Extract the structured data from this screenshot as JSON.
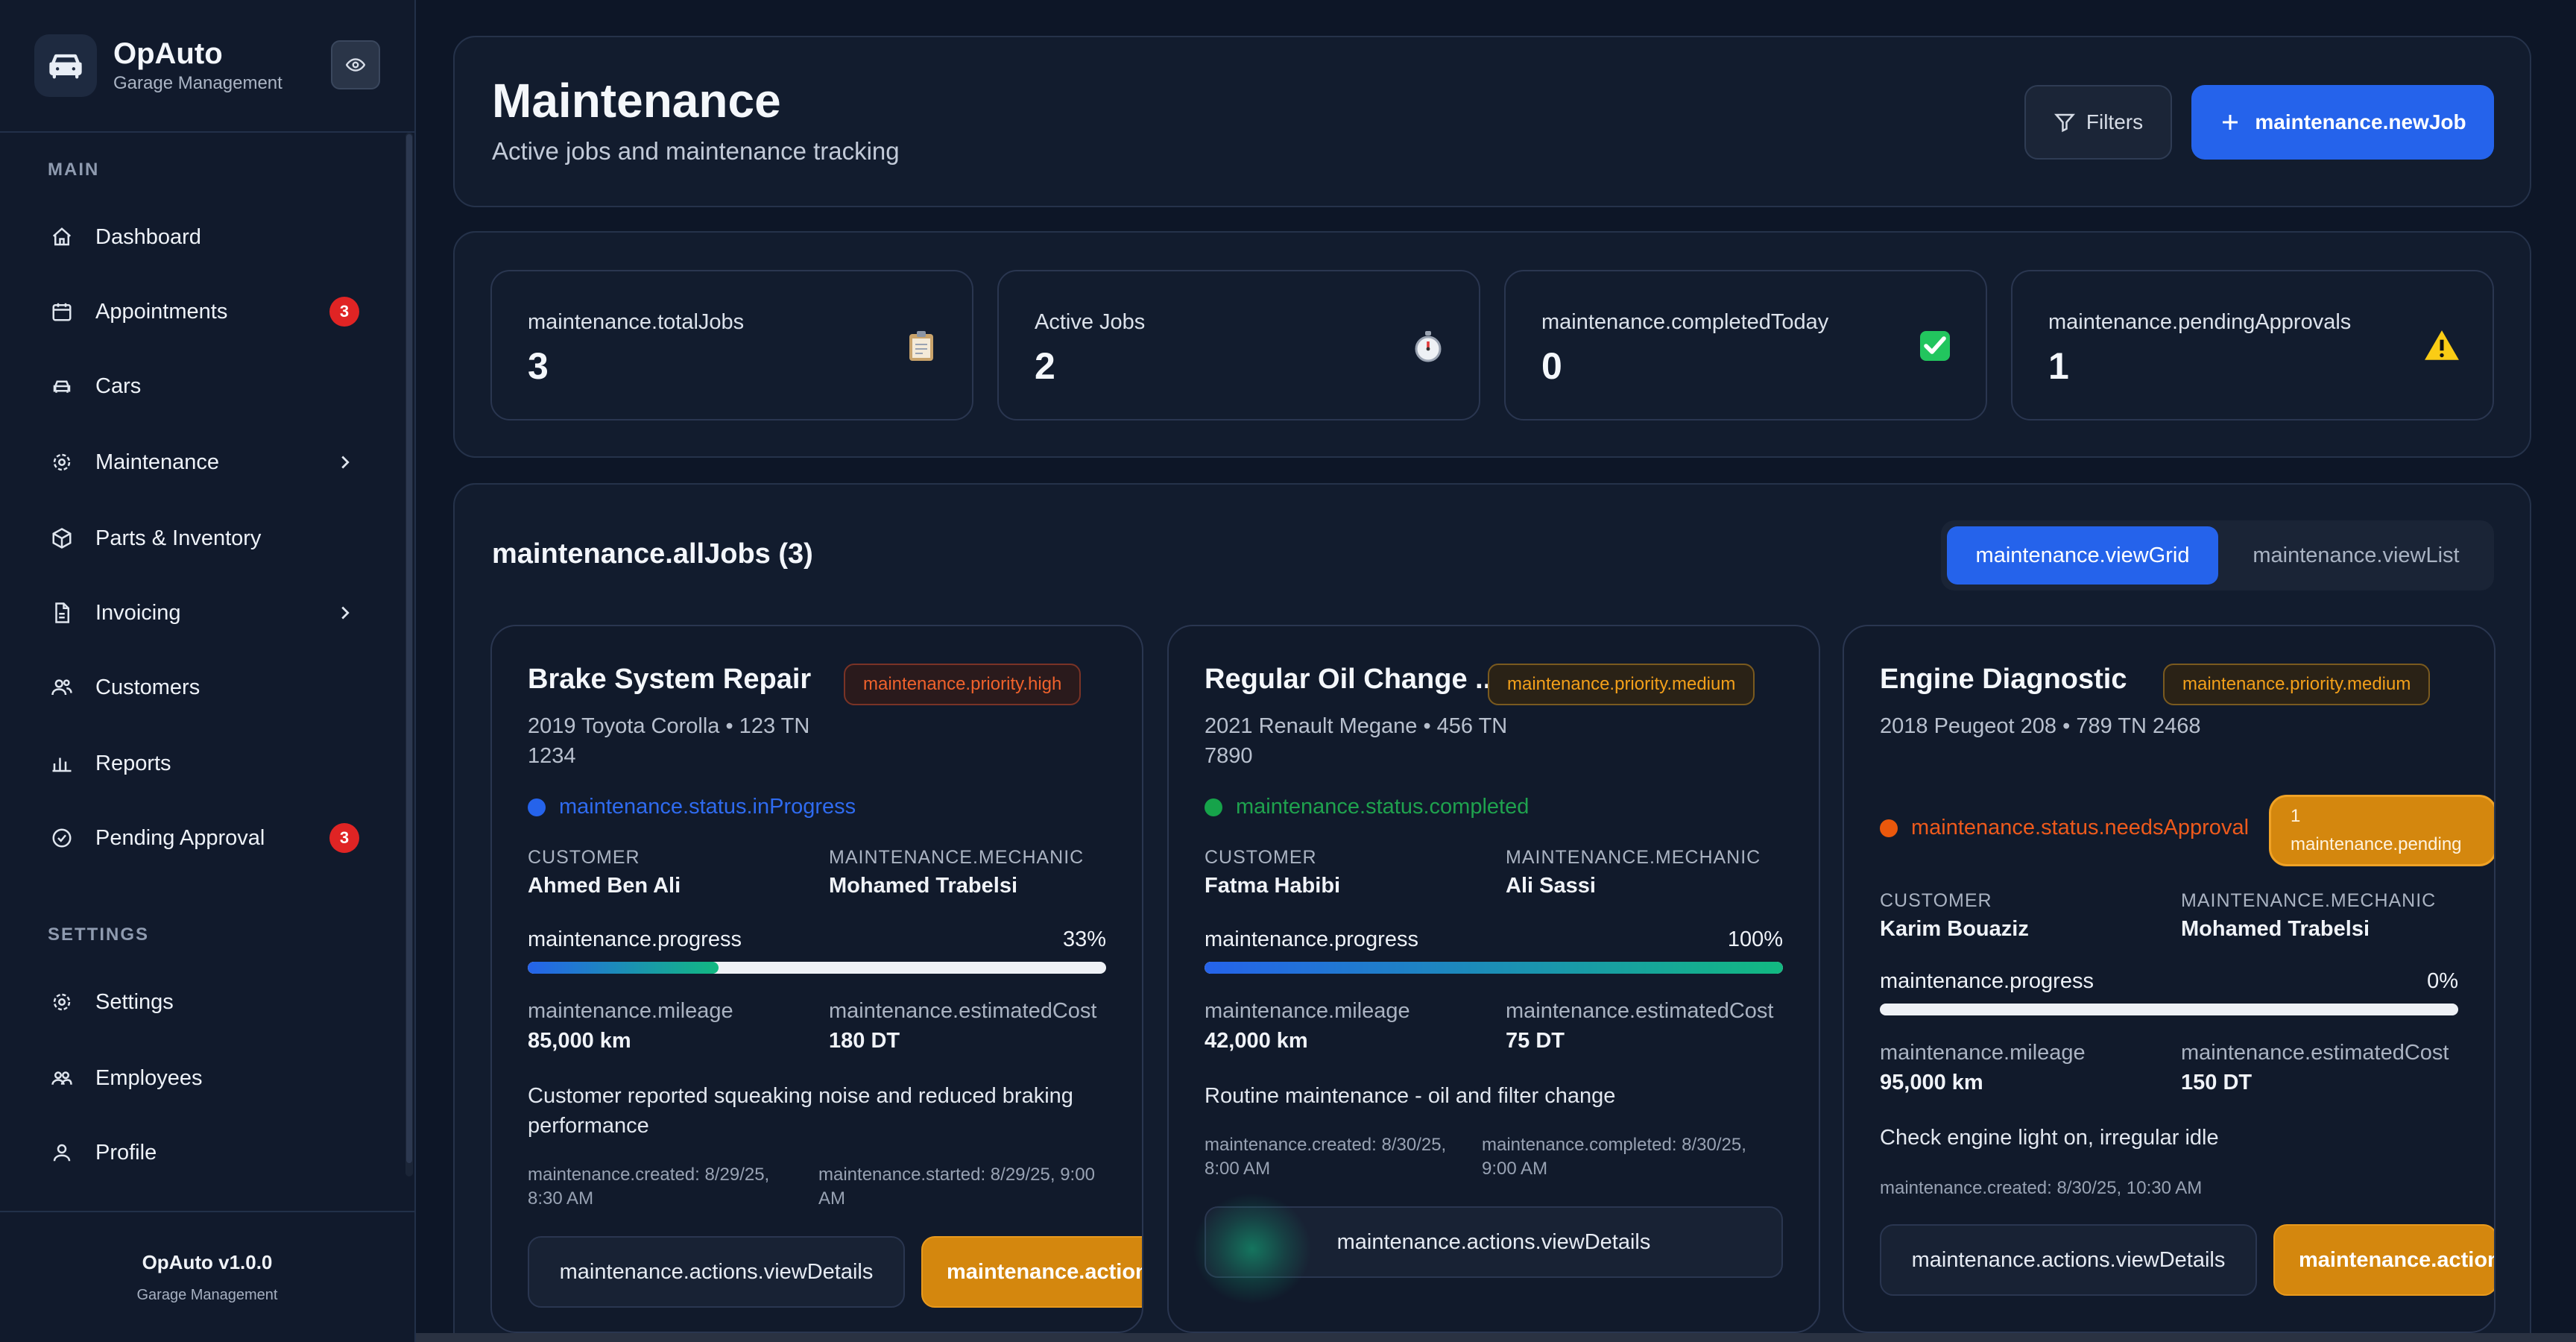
{
  "brand": {
    "name": "OpAuto",
    "subtitle": "Garage Management"
  },
  "sidebar": {
    "main_section": "MAIN",
    "settings_section": "SETTINGS",
    "items": [
      {
        "label": "Dashboard",
        "icon": "home-icon"
      },
      {
        "label": "Appointments",
        "icon": "calendar-icon",
        "badge": "3"
      },
      {
        "label": "Cars",
        "icon": "car-icon"
      },
      {
        "label": "Maintenance",
        "icon": "gear-icon",
        "chevron": true
      },
      {
        "label": "Parts & Inventory",
        "icon": "box-icon"
      },
      {
        "label": "Invoicing",
        "icon": "document-icon",
        "chevron": true
      },
      {
        "label": "Customers",
        "icon": "users-icon"
      },
      {
        "label": "Reports",
        "icon": "bar-chart-icon"
      },
      {
        "label": "Pending Approval",
        "icon": "check-circle-icon",
        "badge": "3"
      }
    ],
    "settings_items": [
      {
        "label": "Settings",
        "icon": "gear-icon"
      },
      {
        "label": "Employees",
        "icon": "users-icon"
      },
      {
        "label": "Profile",
        "icon": "user-icon"
      }
    ],
    "footer": {
      "version": "OpAuto v1.0.0",
      "subtitle": "Garage Management"
    }
  },
  "header": {
    "title": "Maintenance",
    "subtitle": "Active jobs and maintenance tracking",
    "filters_label": "Filters",
    "new_job_label": "maintenance.newJob"
  },
  "stats": [
    {
      "label": "maintenance.totalJobs",
      "value": "3",
      "icon": "clipboard-icon"
    },
    {
      "label": "Active Jobs",
      "value": "2",
      "icon": "stopwatch-icon"
    },
    {
      "label": "maintenance.completedToday",
      "value": "0",
      "icon": "check-mark-icon"
    },
    {
      "label": "maintenance.pendingApprovals",
      "value": "1",
      "icon": "warning-icon"
    }
  ],
  "jobs_section": {
    "title": "maintenance.allJobs (3)",
    "view_grid": "maintenance.viewGrid",
    "view_list": "maintenance.viewList"
  },
  "labels": {
    "customer": "CUSTOMER",
    "mechanic": "MAINTENANCE.MECHANIC",
    "progress": "maintenance.progress",
    "mileage": "maintenance.mileage",
    "estimated_cost": "maintenance.estimatedCost",
    "view_details": "maintenance.actions.viewDetails",
    "edit": "maintenance.actions.edit",
    "pending_count": "1",
    "pending_label": "maintenance.pending"
  },
  "jobs": [
    {
      "title": "Brake System Repair",
      "priority": "maintenance.priority.high",
      "car": "2019 Toyota Corolla • 123 TN 1234",
      "status": "maintenance.status.inProgress",
      "status_color": "#2563eb",
      "customer": "Ahmed Ben Ali",
      "mechanic": "Mohamed Trabelsi",
      "progress": 33,
      "progress_text": "33%",
      "mileage": "85,000 km",
      "cost": "180 DT",
      "description": "Customer reported squeaking noise and reduced braking performance",
      "meta_left": "maintenance.created: 8/29/25, 8:30 AM",
      "meta_right": "maintenance.started: 8/29/25, 9:00 AM",
      "edit_label": "maintenance.actions.edit"
    },
    {
      "title": "Regular Oil Change ...",
      "priority": "maintenance.priority.medium",
      "car": "2021 Renault Megane • 456 TN 7890",
      "status": "maintenance.status.completed",
      "status_color": "#16a34a",
      "customer": "Fatma Habibi",
      "mechanic": "Ali Sassi",
      "progress": 100,
      "progress_text": "100%",
      "mileage": "42,000 km",
      "cost": "75 DT",
      "description": "Routine maintenance - oil and filter change",
      "meta_left": "maintenance.created: 8/30/25, 8:00 AM",
      "meta_right": "maintenance.completed: 8/30/25, 9:00 AM"
    },
    {
      "title": "Engine Diagnostic",
      "priority": "maintenance.priority.medium",
      "car": "2018 Peugeot 208 • 789 TN 2468",
      "status": "maintenance.status.needsApproval",
      "status_color": "#ea580c",
      "customer": "Karim Bouaziz",
      "mechanic": "Mohamed Trabelsi",
      "progress": 0,
      "progress_text": "0%",
      "mileage": "95,000 km",
      "cost": "150 DT",
      "description": "Check engine light on, irregular idle",
      "meta_left": "maintenance.created: 8/30/25, 10:30 AM",
      "edit_label": "maintenance.actions.edit"
    }
  ],
  "colors": {
    "background": "#0d1627",
    "accent": "#2563eb",
    "warning": "#d4870e",
    "danger": "#e02424",
    "success": "#12b981"
  }
}
